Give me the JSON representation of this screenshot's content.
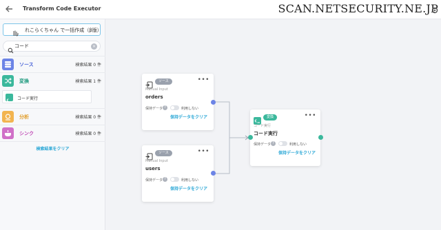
{
  "header": {
    "title": "Transform Code Executor",
    "watermark": "SCAN.NETSECURITY.NE.JP"
  },
  "sidebar": {
    "category_button": "れこらくちゃん で一括作成（β版）",
    "search": {
      "value": "コード",
      "placeholder": ""
    },
    "sections": [
      {
        "name": "ソース",
        "count": "検索結果 0 件",
        "color": "#6c84e6",
        "text_color": "#4a64d8"
      },
      {
        "name": "変換",
        "count": "検索結果 1 件",
        "color": "#3bb89c",
        "text_color": "#1e9a7e"
      },
      {
        "name": "分析",
        "count": "検索結果 0 件",
        "color": "#f2b450",
        "text_color": "#e09a22"
      },
      {
        "name": "シンク",
        "count": "検索結果 0 件",
        "color": "#d070c8",
        "text_color": "#c04cb6"
      }
    ],
    "result_item": "コード実行",
    "clear_label": "検索結果をクリア"
  },
  "nodes": [
    {
      "tag": "ソース",
      "subtitle": "Manual Input",
      "name": "orders",
      "keep_label": "保持データ",
      "toggle_label": "利用しない",
      "clear_label": "保持データをクリア"
    },
    {
      "tag": "ソース",
      "subtitle": "Manual Input",
      "name": "users",
      "keep_label": "保持データ",
      "toggle_label": "利用しない",
      "clear_label": "保持データをクリア"
    },
    {
      "tag": "変換",
      "subtitle": "コード実行",
      "name": "コード実行",
      "keep_label": "保持データ",
      "toggle_label": "利用しない",
      "clear_label": "保持データをクリア"
    }
  ],
  "colors": {
    "source_port": "#6c84e6",
    "transform_port": "#3bb89c",
    "link": "#2aa7d6"
  }
}
